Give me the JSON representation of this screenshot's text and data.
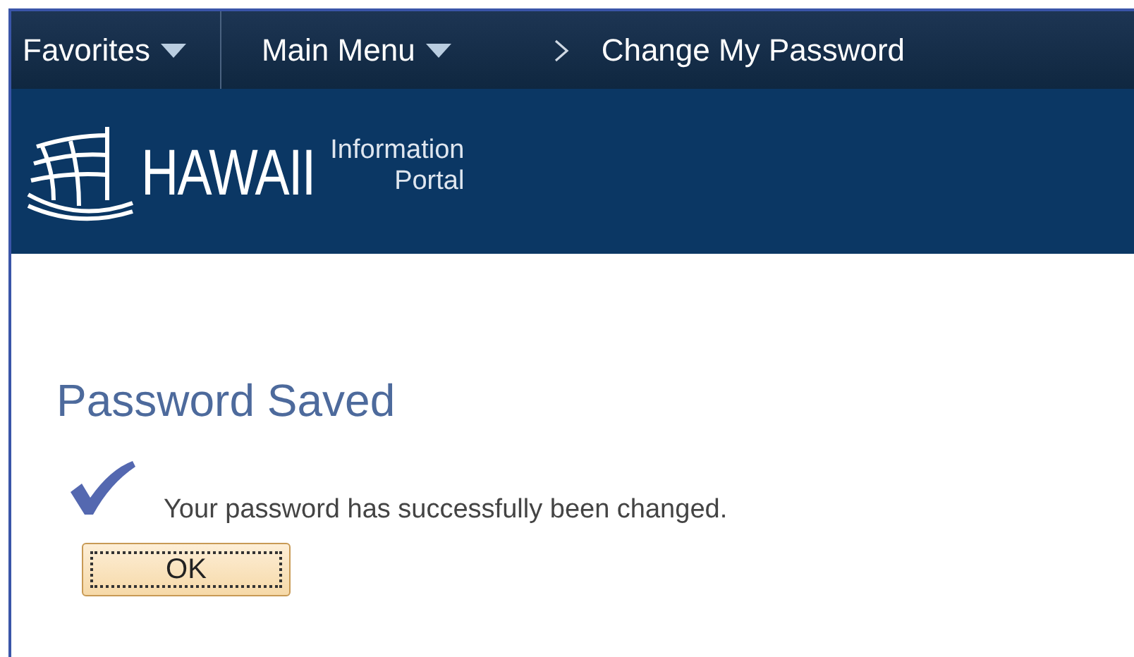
{
  "nav": {
    "items": [
      {
        "label": "Favorites",
        "kind": "dropdown"
      },
      {
        "label": "Main Menu",
        "kind": "dropdown"
      }
    ],
    "breadcrumb": "Change My Password"
  },
  "banner": {
    "logo_word": "HAWAII",
    "logo_sub_1": "Information",
    "logo_sub_2": "Portal"
  },
  "content": {
    "title": "Password Saved",
    "message": "Your password has successfully been changed.",
    "button": "OK"
  }
}
